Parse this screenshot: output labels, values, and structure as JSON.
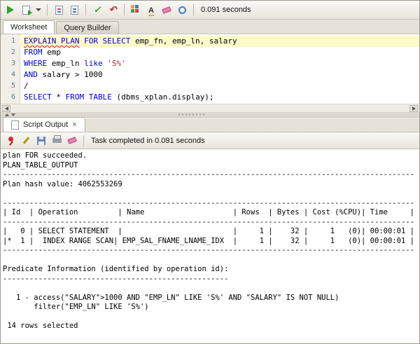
{
  "top_toolbar": {
    "time": "0.091 seconds",
    "icons": [
      {
        "name": "run-statement",
        "kind": "play"
      },
      {
        "name": "run-script",
        "kind": "doc-green"
      },
      {
        "name": "run-script-menu",
        "kind": "caret"
      },
      {
        "kind": "sep"
      },
      {
        "name": "autotrace",
        "kind": "doc-trace"
      },
      {
        "name": "explain-plan",
        "kind": "doc-plan"
      },
      {
        "kind": "sep"
      },
      {
        "name": "commit",
        "kind": "commit"
      },
      {
        "name": "rollback",
        "kind": "rollback"
      },
      {
        "kind": "sep"
      },
      {
        "name": "sql-tuning-advisor",
        "kind": "grid"
      },
      {
        "name": "format",
        "kind": "format"
      },
      {
        "name": "clear",
        "kind": "eraser"
      },
      {
        "name": "sql-history",
        "kind": "clock"
      },
      {
        "kind": "sep"
      }
    ]
  },
  "worksheet_tabs": {
    "0": {
      "label": "Worksheet"
    },
    "1": {
      "label": "Query Builder"
    }
  },
  "editor": {
    "lines": [
      {
        "n": "1",
        "hl": true,
        "tokens": [
          {
            "t": "EXPLAIN PLAN",
            "c": "kw err"
          },
          {
            "t": " FOR SELECT",
            "c": "kw"
          },
          {
            "t": " emp_fn, emp_ln, salary",
            "c": "pl"
          }
        ]
      },
      {
        "n": "2",
        "hl": false,
        "tokens": [
          {
            "t": "FROM",
            "c": "kw"
          },
          {
            "t": " emp",
            "c": "pl"
          }
        ]
      },
      {
        "n": "3",
        "hl": false,
        "tokens": [
          {
            "t": "WHERE",
            "c": "kw"
          },
          {
            "t": " emp_ln ",
            "c": "pl"
          },
          {
            "t": "like",
            "c": "kw"
          },
          {
            "t": " ",
            "c": "pl"
          },
          {
            "t": "'S%'",
            "c": "str"
          }
        ]
      },
      {
        "n": "4",
        "hl": false,
        "tokens": [
          {
            "t": "AND",
            "c": "kw"
          },
          {
            "t": " salary > 1000",
            "c": "pl"
          }
        ]
      },
      {
        "n": "5",
        "hl": false,
        "tokens": [
          {
            "t": "/",
            "c": "pl"
          }
        ]
      },
      {
        "n": "6",
        "hl": false,
        "tokens": [
          {
            "t": "SELECT",
            "c": "kw"
          },
          {
            "t": " * ",
            "c": "pl"
          },
          {
            "t": "FROM TABLE",
            "c": "kw"
          },
          {
            "t": " (dbms_xplan.display);",
            "c": "pl"
          }
        ]
      }
    ]
  },
  "output_tab": {
    "label": "Script Output",
    "close": "×"
  },
  "output_toolbar": {
    "status": "Task completed in 0.091 seconds",
    "icons": [
      {
        "name": "pin",
        "kind": "pin"
      },
      {
        "name": "edit",
        "kind": "pencil"
      },
      {
        "name": "save",
        "kind": "floppy"
      },
      {
        "name": "print",
        "kind": "printer"
      },
      {
        "name": "clear-output",
        "kind": "eraser"
      },
      {
        "kind": "sep"
      }
    ]
  },
  "output": {
    "lines": [
      "plan FOR succeeded.",
      "PLAN_TABLE_OUTPUT",
      "---------------------------------------------------------------------------------------------",
      "Plan hash value: 4062553269",
      "",
      "---------------------------------------------------------------------------------------------",
      "| Id  | Operation         | Name                    | Rows  | Bytes | Cost (%CPU)| Time     |",
      "---------------------------------------------------------------------------------------------",
      "|   0 | SELECT STATEMENT  |                         |     1 |    32 |     1   (0)| 00:00:01 |",
      "|*  1 |  INDEX RANGE SCAN| EMP_SAL_FNAME_LNAME_IDX  |     1 |    32 |     1   (0)| 00:00:01 |",
      "---------------------------------------------------------------------------------------------",
      "",
      "Predicate Information (identified by operation id):",
      "---------------------------------------------------",
      "",
      "   1 - access(\"SALARY\">1000 AND \"EMP_LN\" LIKE 'S%' AND \"SALARY\" IS NOT NULL)",
      "       filter(\"EMP_LN\" LIKE 'S%')",
      "",
      " 14 rows selected "
    ]
  }
}
